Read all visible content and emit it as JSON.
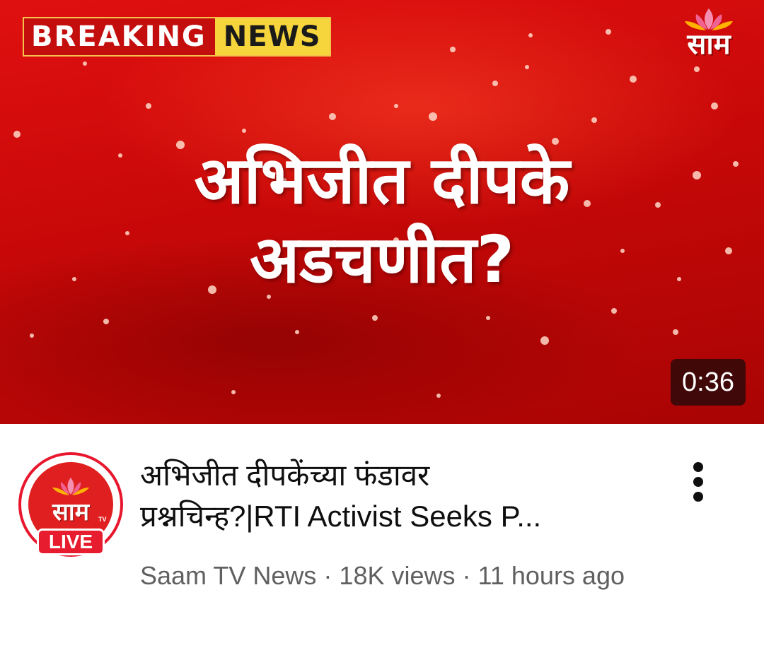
{
  "thumbnail": {
    "breaking_label_1": "BREAKING",
    "breaking_label_2": "NEWS",
    "channel_logo_text": "साम",
    "headline_line_1": "अभिजीत दीपके",
    "headline_line_2": "अडचणीत?",
    "duration": "0:36",
    "colors": {
      "background": "#d40c0c",
      "breaking_red": "#c40d0d",
      "breaking_yellow": "#f6d53c"
    }
  },
  "video": {
    "title_line_1": "अभिजीत दीपकेंच्या फंडावर",
    "title_line_2": "प्रश्नचिन्ह?|RTI Activist Seeks P...",
    "channel_name": "Saam TV News",
    "separator": "·",
    "views": "18K views",
    "published": "11 hours ago"
  },
  "avatar": {
    "logo_text": "साम",
    "tv_mark": "TV",
    "live_badge": "LIVE",
    "ring_color": "#e8172d"
  },
  "menu": {
    "icon": "more-vert-icon"
  }
}
